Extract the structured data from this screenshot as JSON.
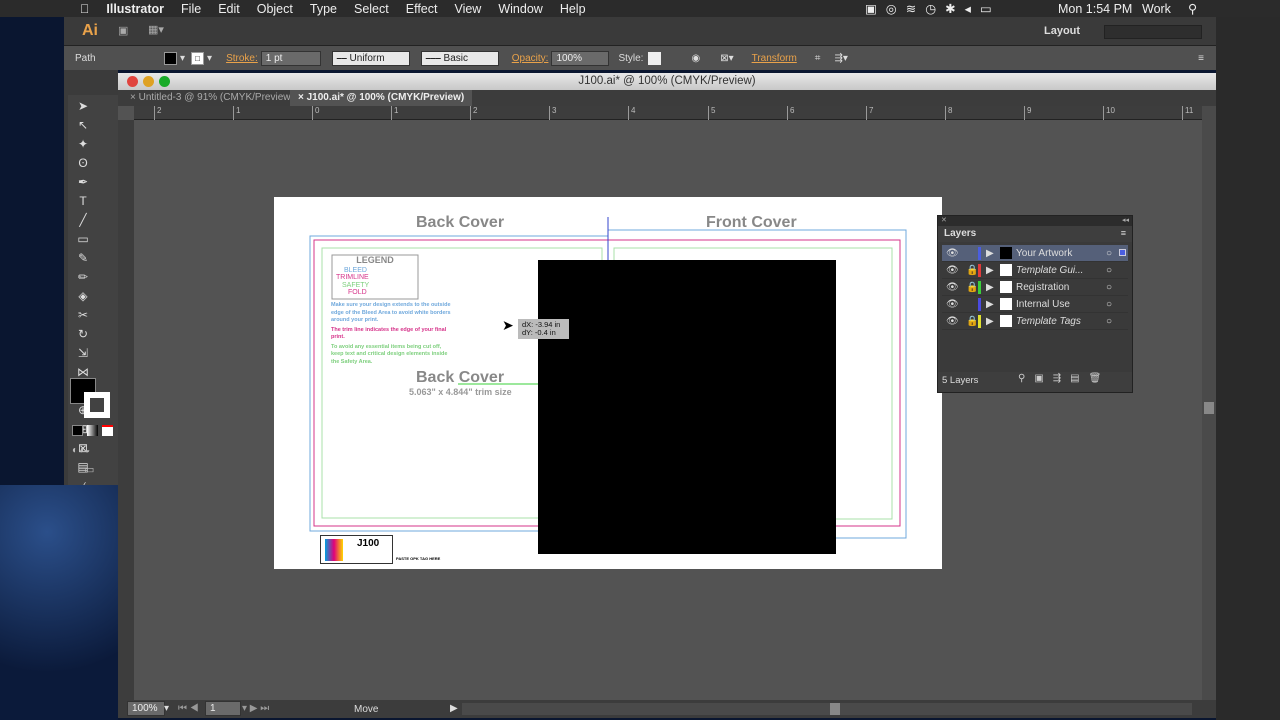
{
  "menubar": {
    "apple": "",
    "app": "Illustrator",
    "items": [
      "File",
      "Edit",
      "Object",
      "Type",
      "Select",
      "Effect",
      "View",
      "Window",
      "Help"
    ],
    "clock": "Mon 1:54 PM",
    "user": "Work"
  },
  "appbar": {
    "logo": "Ai",
    "workspace": "Layout"
  },
  "control": {
    "selection": "Path",
    "stroke_label": "Stroke:",
    "stroke_value": "1 pt",
    "profile": "Uniform",
    "brush": "Basic",
    "opacity_label": "Opacity:",
    "opacity_value": "100%",
    "style_label": "Style:",
    "transform": "Transform"
  },
  "window": {
    "title": "J100.ai* @ 100% (CMYK/Preview)",
    "tabs": [
      {
        "label": "Untitled-3 @ 91% (CMYK/Preview)",
        "active": false
      },
      {
        "label": "J100.ai* @ 100% (CMYK/Preview)",
        "active": true
      }
    ]
  },
  "artboard": {
    "back_cover": "Back Cover",
    "front_cover": "Front Cover",
    "center_title": "Back Cover",
    "trim_size": "5.063\" x 4.844\" trim size",
    "legend": {
      "title": "LEGEND",
      "items": [
        {
          "label": "BLEED",
          "color": "#6fa8dc"
        },
        {
          "label": "TRIMLINE",
          "color": "#d6338a"
        },
        {
          "label": "SAFETY",
          "color": "#7dcf7d"
        },
        {
          "label": "FOLD",
          "color": "#d6338a"
        }
      ]
    },
    "notes": [
      {
        "text": "Make sure your design extends to the outside edge of the Bleed Area to avoid white borders around your print.",
        "color": "#6fa8dc"
      },
      {
        "text": "The trim line indicates the edge of your final print.",
        "color": "#d6338a"
      },
      {
        "text": "To avoid any essential items being cut off, keep text and critical design elements inside the Safety Area.",
        "color": "#7dcf7d"
      }
    ],
    "logo_text": "J100",
    "paste_tag": "PASTE OPK TAG HERE"
  },
  "tooltip": {
    "dx": "dX: -3.94 in",
    "dy": "dY: -0.4 in"
  },
  "layers": {
    "title": "Layers",
    "count": "5 Layers",
    "items": [
      {
        "name": "Your Artwork",
        "color": "#4a5ee0",
        "locked": false,
        "selected": true,
        "italic": false
      },
      {
        "name": "Template Gui...",
        "color": "#e03a3a",
        "locked": true,
        "selected": false,
        "italic": true
      },
      {
        "name": "Registration",
        "color": "#3ad03a",
        "locked": true,
        "selected": false,
        "italic": false
      },
      {
        "name": "Internal Use",
        "color": "#4a4ae0",
        "locked": false,
        "selected": false,
        "italic": false
      },
      {
        "name": "Template Tags",
        "color": "#e0e030",
        "locked": true,
        "selected": false,
        "italic": true
      }
    ]
  },
  "status": {
    "zoom": "100%",
    "page": "1",
    "tool": "Move"
  },
  "ruler": [
    "2",
    "1",
    "0",
    "1",
    "2",
    "3",
    "4",
    "5",
    "6",
    "7",
    "8",
    "9",
    "10",
    "11"
  ]
}
